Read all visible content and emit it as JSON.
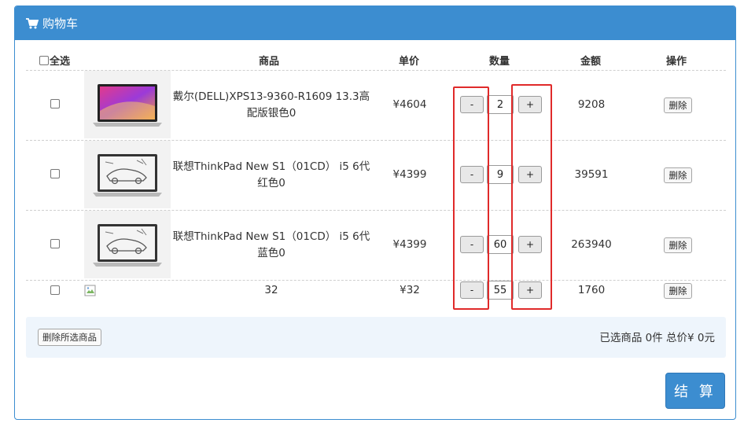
{
  "panel": {
    "title": "购物车",
    "icon": "shopping-cart-icon"
  },
  "header": {
    "select_all": "全选",
    "product": "商品",
    "unit_price": "单价",
    "quantity": "数量",
    "amount": "金额",
    "actions": "操作"
  },
  "items": [
    {
      "name_line1": "戴尔(DELL)XPS13-9360-R1609 13.3高",
      "name_line2": "配版银色0",
      "price": "¥4604",
      "minus": "-",
      "qty": "2",
      "plus": "+",
      "amount": "9208",
      "delete": "删除"
    },
    {
      "name_line1": "联想ThinkPad New S1（01CD） i5 6代",
      "name_line2": "红色0",
      "price": "¥4399",
      "minus": "-",
      "qty": "9",
      "plus": "+",
      "amount": "39591",
      "delete": "删除"
    },
    {
      "name_line1": "联想ThinkPad New S1（01CD） i5 6代",
      "name_line2": "蓝色0",
      "price": "¥4399",
      "minus": "-",
      "qty": "60",
      "plus": "+",
      "amount": "263940",
      "delete": "删除"
    },
    {
      "name_line1": "32",
      "name_line2": "",
      "price": "¥32",
      "minus": "-",
      "qty": "55",
      "plus": "+",
      "amount": "1760",
      "delete": "删除"
    }
  ],
  "footer": {
    "delete_selected": "删除所选商品",
    "summary": "已选商品 0件 总价¥ 0元"
  },
  "checkout": "结 算",
  "colors": {
    "primary": "#3c8dd0",
    "highlight": "#e02a2a",
    "footer_bg": "#eef5fc"
  }
}
